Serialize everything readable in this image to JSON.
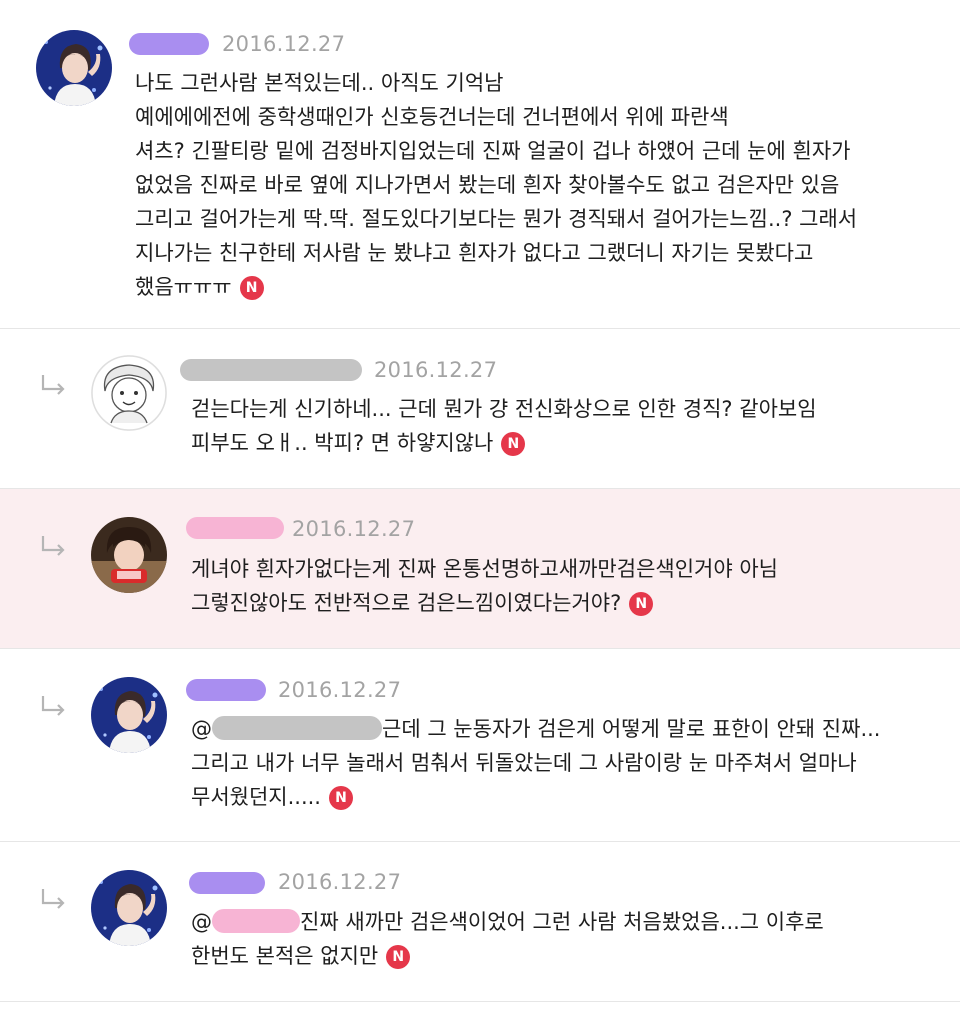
{
  "comments": [
    {
      "date": "2016.12.27",
      "name_color": "#a98ef0",
      "lines": [
        "나도 그런사람 본적있는데.. 아직도 기억남",
        "예에에에전에 중학생때인가 신호등건너는데 건너편에서 위에 파란색",
        "셔츠? 긴팔티랑 밑에 검정바지입었는데 진짜 얼굴이 겁나 하얬어 근데 눈에 흰자가",
        "없었음 진짜로 바로 옆에 지나가면서 봤는데 흰자 찾아볼수도 없고 검은자만 있음",
        "그리고 걸어가는게 딱.딱. 절도있다기보다는 뭔가 경직돼서 걸어가는느낌..? 그래서",
        "지나가는 친구한테 저사람 눈 봤냐고 흰자가 없다고 그랬더니 자기는 못봤다고",
        "했음ㅠㅠㅠ"
      ]
    },
    {
      "date": "2016.12.27",
      "name_color": "#c4c4c4",
      "lines": [
        "걷는다는게 신기하네... 근데 뭔가 걍 전신화상으로 인한 경직? 같아보임",
        "피부도 오ㅐ.. 박피? 면 하얗지않나"
      ]
    },
    {
      "date": "2016.12.27",
      "name_color": "#f7b4d4",
      "lines": [
        "게녀야 흰자가없다는게 진짜 온통선명하고새까만검은색인거야 아님",
        "그렇진않아도 전반적으로 검은느낌이였다는거야?"
      ]
    },
    {
      "date": "2016.12.27",
      "name_color": "#a98ef0",
      "mention_prefix": "@",
      "mention_color": "#c4c4c4",
      "lines": [
        "근데 그 눈동자가 검은게 어떻게 말로 표한이 안돼 진짜...",
        "그리고 내가 너무 놀래서 멈춰서 뒤돌았는데 그 사람이랑 눈 마주쳐서 얼마나",
        "무서웠던지....."
      ]
    },
    {
      "date": "2016.12.27",
      "name_color": "#a98ef0",
      "mention_prefix": "@",
      "mention_color": "#f7b4d4",
      "lines": [
        "진짜 새까만 검은색이었어 그런 사람 처음봤었음...그 이후로",
        "한번도 본적은 없지만"
      ]
    }
  ],
  "badge_label": "N",
  "icons": {
    "reply": "reply-arrow-icon",
    "new": "new-badge-icon"
  },
  "colors": {
    "badge": "#e5374a",
    "highlight_bg": "#fbeef0",
    "date": "#a3a3a3"
  }
}
